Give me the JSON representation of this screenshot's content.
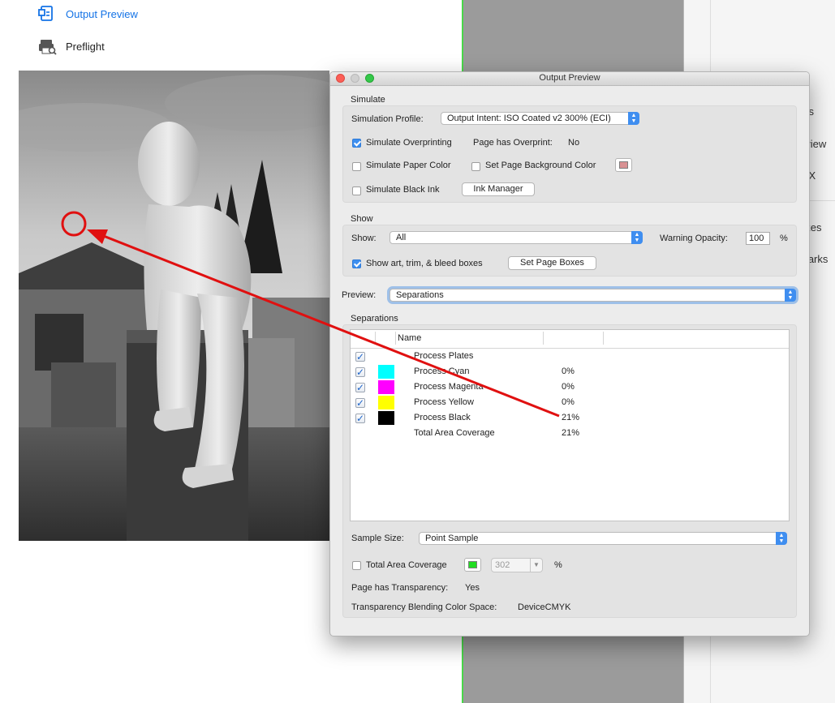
{
  "tools": {
    "output_preview": "Output Preview",
    "preflight": "Preflight",
    "fragments": [
      "ors",
      "eview",
      "F/X",
      "oxes",
      "Marks"
    ]
  },
  "dialog": {
    "title": "Output Preview",
    "simulate": {
      "section_label": "Simulate",
      "profile_label": "Simulation Profile:",
      "profile_value": "Output Intent: ISO Coated v2 300% (ECI)",
      "overprinting_label": "Simulate Overprinting",
      "overprinting_checked": true,
      "page_overprint_label": "Page has Overprint:",
      "page_overprint_value": "No",
      "paper_color_label": "Simulate Paper Color",
      "paper_color_checked": false,
      "bg_color_label": "Set Page Background Color",
      "bg_color_checked": false,
      "bg_swatch_color": "#d99294",
      "black_ink_label": "Simulate Black Ink",
      "black_ink_checked": false,
      "ink_manager_label": "Ink Manager"
    },
    "show": {
      "section_label": "Show",
      "show_label": "Show:",
      "show_value": "All",
      "warning_opacity_label": "Warning Opacity:",
      "warning_opacity_value": "100",
      "percent": "%",
      "boxes_label": "Show art, trim, & bleed boxes",
      "boxes_checked": true,
      "set_boxes_label": "Set Page Boxes"
    },
    "preview": {
      "label": "Preview:",
      "value": "Separations"
    },
    "separations": {
      "section_label": "Separations",
      "column_name": "Name",
      "rows": [
        {
          "checked": true,
          "color": "",
          "name": "Process Plates",
          "percent": ""
        },
        {
          "checked": true,
          "color": "#00ffff",
          "name": "Process Cyan",
          "percent": "0%"
        },
        {
          "checked": true,
          "color": "#ff00ff",
          "name": "Process Magenta",
          "percent": "0%"
        },
        {
          "checked": true,
          "color": "#ffff00",
          "name": "Process Yellow",
          "percent": "0%"
        },
        {
          "checked": true,
          "color": "#000000",
          "name": "Process Black",
          "percent": "21%"
        },
        {
          "checked": false,
          "color": "",
          "name": "Total Area Coverage",
          "percent": "21%"
        }
      ]
    },
    "sample_size": {
      "label": "Sample Size:",
      "value": "Point Sample"
    },
    "total_area": {
      "label": "Total Area Coverage",
      "checked": false,
      "swatch_color": "#22dd22",
      "value": "302",
      "percent": "%"
    },
    "transparency": {
      "label": "Page has Transparency:",
      "value": "Yes"
    },
    "blending": {
      "label": "Transparency Blending Color Space:",
      "value": "DeviceCMYK"
    }
  },
  "annotation": {
    "color": "#e01010"
  }
}
